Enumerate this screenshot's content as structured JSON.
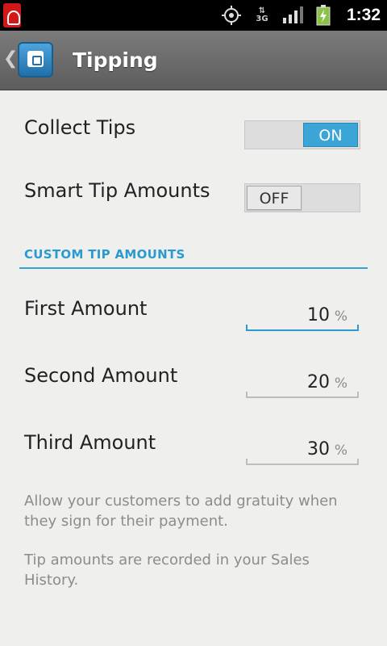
{
  "status_bar": {
    "time": "1:32",
    "network_type": "3G",
    "icons": [
      "app-notification-icon",
      "gps-icon",
      "network-3g-icon",
      "signal-icon",
      "battery-charging-icon"
    ]
  },
  "action_bar": {
    "title": "Tipping",
    "back_icon": "chevron-left-icon",
    "logo_icon": "app-logo-icon"
  },
  "settings": {
    "collect_tips": {
      "label": "Collect Tips",
      "state_label": "ON",
      "enabled": true
    },
    "smart_tip_amounts": {
      "label": "Smart Tip Amounts",
      "state_label": "OFF",
      "enabled": false
    }
  },
  "custom_tip_amounts": {
    "header": "CUSTOM TIP AMOUNTS",
    "items": [
      {
        "label": "First Amount",
        "value": "10",
        "unit": "%"
      },
      {
        "label": "Second Amount",
        "value": "20",
        "unit": "%"
      },
      {
        "label": "Third Amount",
        "value": "30",
        "unit": "%"
      }
    ]
  },
  "help": {
    "line1": "Allow your customers to add gratuity when they sign for their payment.",
    "line2": "Tip amounts are recorded in your Sales History."
  },
  "colors": {
    "accent": "#2a9ad0",
    "toggle_on": "#3aa5d6",
    "action_bar": "#6b6b6b"
  }
}
